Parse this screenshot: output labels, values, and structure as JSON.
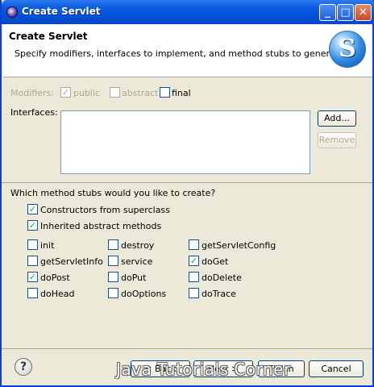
{
  "window": {
    "title": "Create Servlet",
    "minimize": "_",
    "maximize": "□",
    "close": "✕"
  },
  "header": {
    "title": "Create Servlet",
    "description": "Specify modifiers, interfaces to implement, and method stubs to generate.",
    "logo_letter": "S"
  },
  "modifiers": {
    "label": "Modifiers:",
    "public": {
      "label": "public",
      "checked": true,
      "enabled": false
    },
    "abstract": {
      "label": "abstract",
      "checked": false,
      "enabled": false
    },
    "final": {
      "label": "final",
      "checked": false,
      "enabled": true
    }
  },
  "interfaces": {
    "label": "Interfaces:",
    "add_label": "Add...",
    "remove_label": "Remove"
  },
  "stubs": {
    "question": "Which method stubs would you like to create?",
    "constructors": {
      "label": "Constructors from superclass",
      "checked": true
    },
    "inherited": {
      "label": "Inherited abstract methods",
      "checked": true
    },
    "methods": [
      {
        "label": "init",
        "checked": false
      },
      {
        "label": "destroy",
        "checked": false
      },
      {
        "label": "getServletConfig",
        "checked": false
      },
      {
        "label": "getServletInfo",
        "checked": false
      },
      {
        "label": "service",
        "checked": false
      },
      {
        "label": "doGet",
        "checked": true
      },
      {
        "label": "doPost",
        "checked": true
      },
      {
        "label": "doPut",
        "checked": false
      },
      {
        "label": "doDelete",
        "checked": false
      },
      {
        "label": "doHead",
        "checked": false
      },
      {
        "label": "doOptions",
        "checked": false
      },
      {
        "label": "doTrace",
        "checked": false
      }
    ]
  },
  "footer": {
    "help": "?",
    "back_label": "< Back",
    "next_label": "Next >",
    "finish_label": "Finish",
    "cancel_label": "Cancel",
    "watermark": "Java Tutorials Corner"
  },
  "colors": {
    "title_bar": "#0a5ee0",
    "check": "#21a121",
    "dialog_bg": "#ece9d8"
  }
}
